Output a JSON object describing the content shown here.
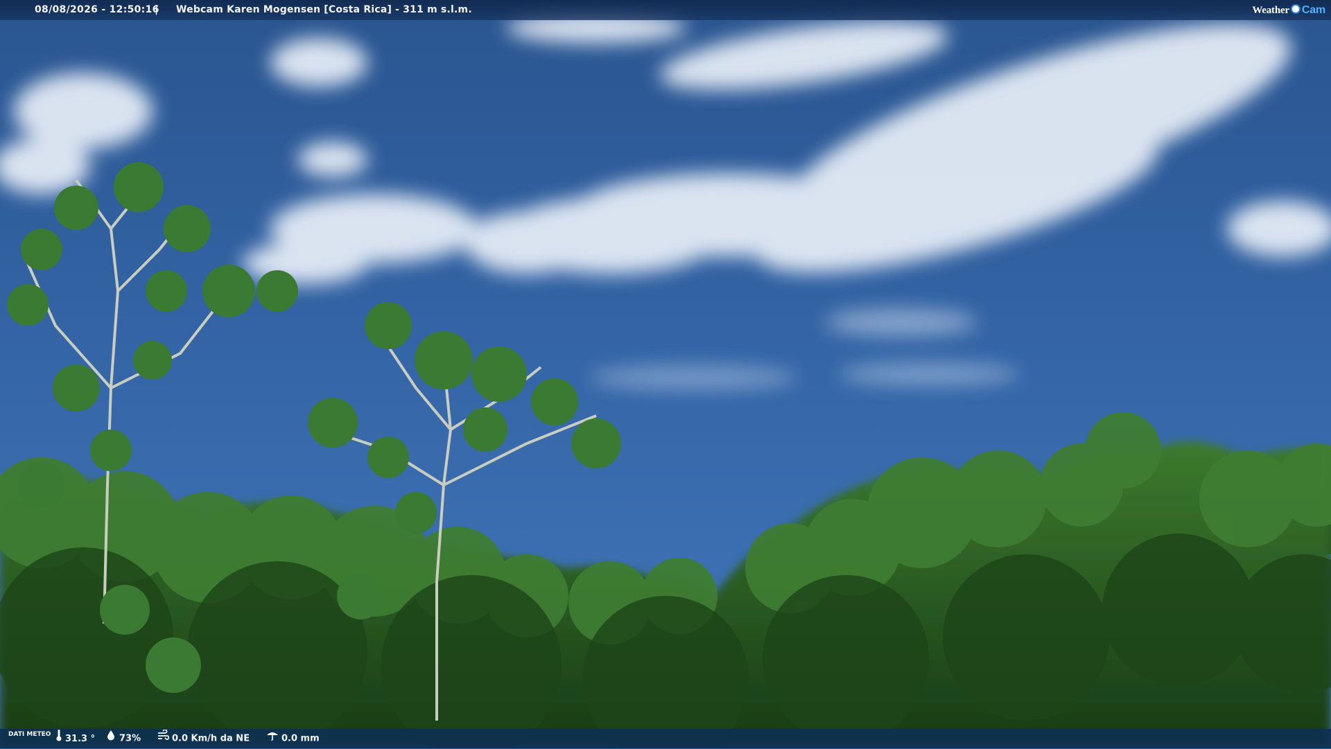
{
  "header": {
    "timestamp": "08/08/2026 - 12:50:16",
    "separator": "|",
    "title": "Webcam Karen Mogensen [Costa Rica] - 311 m s.l.m.",
    "logo_left": "Weather",
    "logo_right": "Cam"
  },
  "footer": {
    "weather_data_label": "DATI METEO",
    "temperature": "31.3 °",
    "humidity": "73%",
    "wind": "0.0 Km/h da NE",
    "rain": "0.0 mm"
  },
  "icons": {
    "temperature": "thermometer-icon",
    "humidity": "humidity-drop-icon",
    "wind": "wind-icon",
    "rain": "rain-gauge-icon"
  },
  "colors": {
    "sky_top": "#2a5590",
    "sky_bottom": "#3f74b6",
    "foliage_dark": "#1f4a1c",
    "foliage_light": "#4d8a3b",
    "bar_background": "#10284e",
    "logo_accent": "#4fb2ff"
  }
}
